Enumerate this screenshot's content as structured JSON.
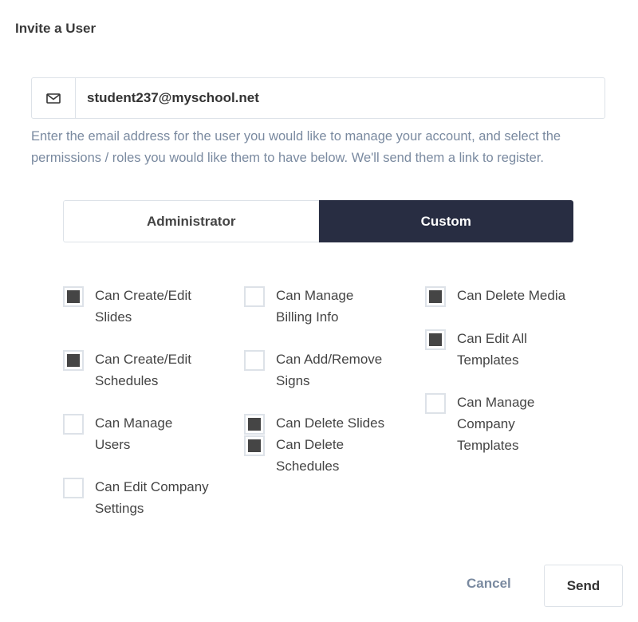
{
  "dialog": {
    "title": "Invite a User"
  },
  "email": {
    "icon": "envelope-icon",
    "value": "student237@myschool.net",
    "help_text": "Enter the email address for the user you would like to manage your account, and select the permissions / roles you would like them to have below. We'll send them a link to register."
  },
  "role_toggle": {
    "options": [
      {
        "label": "Administrator",
        "selected": false
      },
      {
        "label": "Custom",
        "selected": true
      }
    ]
  },
  "permissions": {
    "columns": [
      [
        {
          "label": "Can Create/Edit Slides",
          "checked": true
        },
        {
          "label": "Can Create/Edit Schedules",
          "checked": true
        },
        {
          "label": "Can Manage Users",
          "checked": false
        },
        {
          "label": "Can Edit Company Settings",
          "checked": false
        }
      ],
      [
        {
          "label": "Can Manage Billing Info",
          "checked": false
        },
        {
          "label": "Can Add/Remove Signs",
          "checked": false
        },
        {
          "label": "Can Delete Slides",
          "checked": true
        },
        {
          "label": "Can Delete Schedules",
          "checked": true
        }
      ],
      [
        {
          "label": "Can Delete Media",
          "checked": true
        },
        {
          "label": "Can Edit All Templates",
          "checked": true
        },
        {
          "label": "Can Manage Company Templates",
          "checked": false
        }
      ]
    ]
  },
  "footer": {
    "cancel_label": "Cancel",
    "send_label": "Send"
  },
  "colors": {
    "accent_dark": "#282d42",
    "muted_text": "#7a8aa0",
    "checkbox_fill": "#454545"
  }
}
